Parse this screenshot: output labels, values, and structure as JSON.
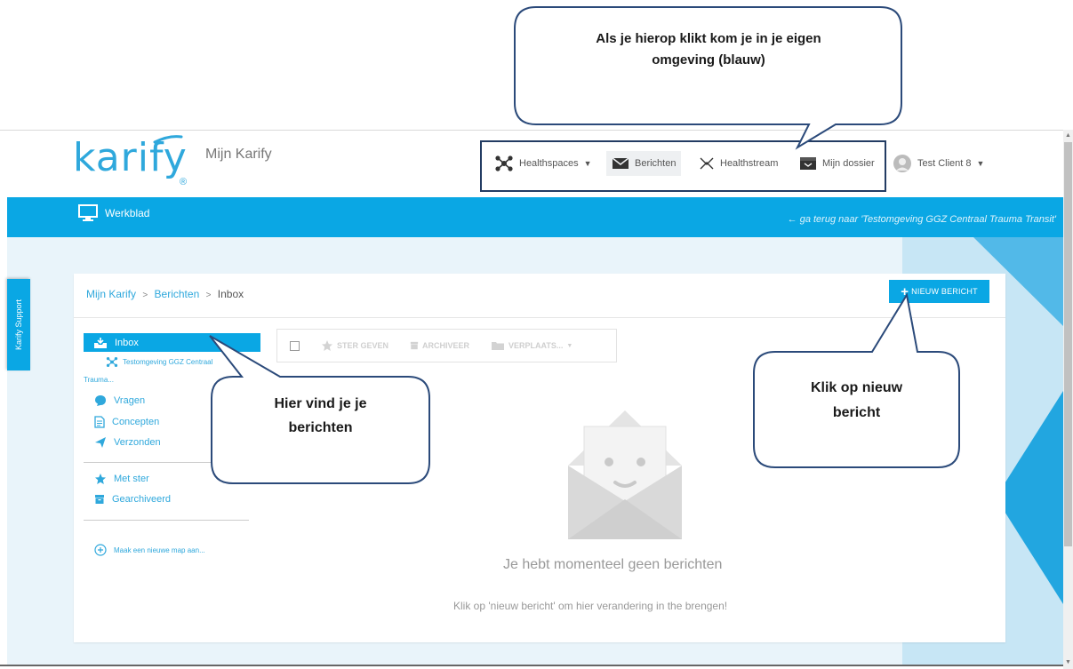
{
  "header": {
    "logo": "karify",
    "logo_reg": "®",
    "app_title": "Mijn Karify",
    "nav": {
      "healthspaces": "Healthspaces",
      "berichten": "Berichten",
      "healthstream": "Healthstream",
      "mijn_dossier": "Mijn dossier",
      "user": "Test Client 8"
    }
  },
  "bluebar": {
    "werkblad": "Werkblad",
    "goback": "← ga terug naar 'Testomgeving GGZ Centraal Trauma Transit'"
  },
  "support_tab": "Karify Support",
  "breadcrumb": {
    "home": "Mijn Karify",
    "sep": ">",
    "berichten": "Berichten",
    "current": "Inbox"
  },
  "new_message_button": "NIEUW BERICHT",
  "sidebar": {
    "inbox": "Inbox",
    "sub_item": "Testomgeving GGZ Centraal",
    "sub_item_cont": "Trauma...",
    "vragen": "Vragen",
    "concepten": "Concepten",
    "verzonden": "Verzonden",
    "met_ster": "Met ster",
    "gearchiveerd": "Gearchiveerd",
    "new_folder": "Maak een nieuwe map aan..."
  },
  "toolbar": {
    "star": "STER GEVEN",
    "archive": "ARCHIVEER",
    "move": "VERPLAATS..."
  },
  "empty_state": {
    "title": "Je hebt momenteel geen berichten",
    "subtitle": "Klik op 'nieuw bericht' om hier verandering in the brengen!"
  },
  "callouts": {
    "top_line1": "Als je hierop klikt kom je in je eigen",
    "top_line2": "omgeving (blauw)",
    "left_line1": "Hier vind je je",
    "left_line2": "berichten",
    "right_line1": "Klik op nieuw",
    "right_line2": "bericht"
  },
  "colors": {
    "accent": "#0aa7e4",
    "callout_border": "#2b4a7a"
  }
}
